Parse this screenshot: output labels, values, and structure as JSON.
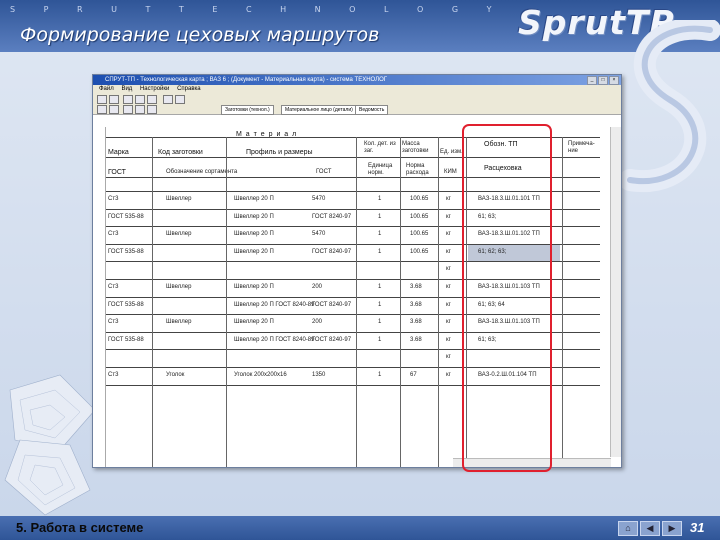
{
  "slide": {
    "tagline": "S P R U T   T E C H N O L O G Y",
    "title": "Формирование цеховых маршрутов",
    "logo": "SprutTP",
    "footer": "5. Работа в системе",
    "number": "31",
    "colors": {
      "band": "#2f5597",
      "highlight": "#e0202e"
    }
  },
  "window": {
    "title": "СПРУТ-ТП - Технологическая карта ; ВАЗ 6 ; (Документ - Материальная карта) - система ТЕХНОЛОГ",
    "menu": [
      "Файл",
      "Вид",
      "Настройки",
      "Справка"
    ],
    "tabs": [
      "Заготовки (технол.)",
      "Материальное лицо (детали)",
      "Ведомость"
    ]
  },
  "table": {
    "material_group": "М а т е р и а л",
    "head1": [
      "Марка",
      "Код заготовки",
      "Профиль и размеры",
      "Кол. дет. из заг.",
      "Масса заготовки",
      "Ед. изм.",
      "Обозн. ТП",
      "Примеча-ние"
    ],
    "head2": [
      "ГОСТ",
      "Обозначение сортамента",
      "ГОСТ",
      "Единица норм.",
      "Норма расхода",
      "КИМ",
      "Расцеховка"
    ],
    "rows": [
      [
        "Ст3",
        "Швеллер",
        "Швеллер 20 П",
        "5470",
        "1",
        "100.65",
        "кг",
        "ВАЗ-18.3.Ш.01.101 ТП"
      ],
      [
        "ГОСТ 535-88",
        "",
        "Швеллер 20 П",
        "ГОСТ 8240-97",
        "1",
        "100.65",
        "кг",
        "61; 63;"
      ],
      [
        "Ст3",
        "Швеллер",
        "Швеллер 20 П",
        "5470",
        "1",
        "100.65",
        "кг",
        "ВАЗ-18.3.Ш.01.102 ТП"
      ],
      [
        "ГОСТ 535-88",
        "",
        "Швеллер 20 П",
        "ГОСТ 8240-97",
        "1",
        "100.65",
        "кг",
        "61; 62; 63;"
      ],
      [
        "",
        "",
        "",
        "",
        "",
        "",
        "кг",
        ""
      ],
      [
        "Ст3",
        "Швеллер",
        "Швеллер 20 П",
        "200",
        "1",
        "3.68",
        "кг",
        "ВАЗ-18.3.Ш.01.103 ТП"
      ],
      [
        "ГОСТ 535-88",
        "",
        "Швеллер 20 П ГОСТ 8240-89",
        "ГОСТ 8240-97",
        "1",
        "3.68",
        "кг",
        "61; 63; 64"
      ],
      [
        "Ст3",
        "Швеллер",
        "Швеллер 20 П",
        "200",
        "1",
        "3.68",
        "кг",
        "ВАЗ-18.3.Ш.01.103 ТП"
      ],
      [
        "ГОСТ 535-88",
        "",
        "Швеллер 20 П ГОСТ 8240-89",
        "ГОСТ 8240-97",
        "1",
        "3.68",
        "кг",
        "61; 63;"
      ],
      [
        "",
        "",
        "",
        "",
        "",
        "",
        "кг",
        ""
      ],
      [
        "Ст3",
        "Уголок",
        "Уголок 200х200х16",
        "1350",
        "1",
        "67",
        "кг",
        "ВАЗ-0.2.Ш.01.104 ТП"
      ]
    ]
  }
}
